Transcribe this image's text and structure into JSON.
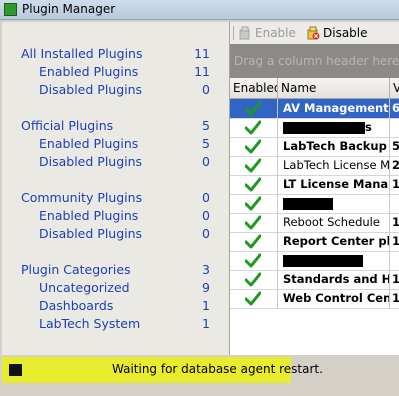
{
  "window": {
    "title": "Plugin Manager"
  },
  "nav": {
    "groups": [
      {
        "label": "All Installed Plugins",
        "count": "11",
        "indent": false
      },
      {
        "label": "Enabled Plugins",
        "count": "11",
        "indent": true
      },
      {
        "label": "Disabled Plugins",
        "count": "0",
        "indent": true
      },
      {
        "label": "Official Plugins",
        "count": "5",
        "indent": false
      },
      {
        "label": "Enabled Plugins",
        "count": "5",
        "indent": true
      },
      {
        "label": "Disabled Plugins",
        "count": "0",
        "indent": true
      },
      {
        "label": "Community Plugins",
        "count": "0",
        "indent": false
      },
      {
        "label": "Enabled Plugins",
        "count": "0",
        "indent": true
      },
      {
        "label": "Disabled Plugins",
        "count": "0",
        "indent": true
      },
      {
        "label": "Plugin Categories",
        "count": "3",
        "indent": false
      },
      {
        "label": "Uncategorized",
        "count": "9",
        "indent": true
      },
      {
        "label": "Dashboards",
        "count": "1",
        "indent": true
      },
      {
        "label": "LabTech System",
        "count": "1",
        "indent": true
      }
    ]
  },
  "toolbar": {
    "enable_label": "Enable",
    "disable_label": "Disable"
  },
  "grid": {
    "group_hint": "Drag a column header here to gro",
    "columns": [
      "Enabled",
      "Name",
      "V"
    ],
    "rows": [
      {
        "name": "AV Management ...",
        "extra": "6",
        "bold": true,
        "selected": true,
        "redacted": false
      },
      {
        "name": "s",
        "extra": "",
        "bold": true,
        "selected": false,
        "redacted": true,
        "redact_width": 82
      },
      {
        "name": "LabTech Backup ...",
        "extra": "5",
        "bold": true,
        "selected": false,
        "redacted": false
      },
      {
        "name": "LabTech License M...",
        "extra": "2",
        "bold": false,
        "selected": false,
        "redacted": false
      },
      {
        "name": "LT License Mana...",
        "extra": "1",
        "bold": true,
        "selected": false,
        "redacted": false
      },
      {
        "name": "",
        "extra": "",
        "bold": false,
        "selected": false,
        "redacted": true,
        "redact_width": 50
      },
      {
        "name": "Reboot Schedule",
        "extra": "1",
        "bold": false,
        "selected": false,
        "redacted": false
      },
      {
        "name": "Report Center pl...",
        "extra": "1",
        "bold": true,
        "selected": false,
        "redacted": false
      },
      {
        "name": "",
        "extra": "",
        "bold": false,
        "selected": false,
        "redacted": true,
        "redact_width": 80
      },
      {
        "name": "Standards and H...",
        "extra": "1",
        "bold": true,
        "selected": false,
        "redacted": false
      },
      {
        "name": "Web Control Cen...",
        "extra": "1",
        "bold": true,
        "selected": false,
        "redacted": false
      }
    ]
  },
  "status": {
    "message": "Waiting for database agent restart."
  }
}
